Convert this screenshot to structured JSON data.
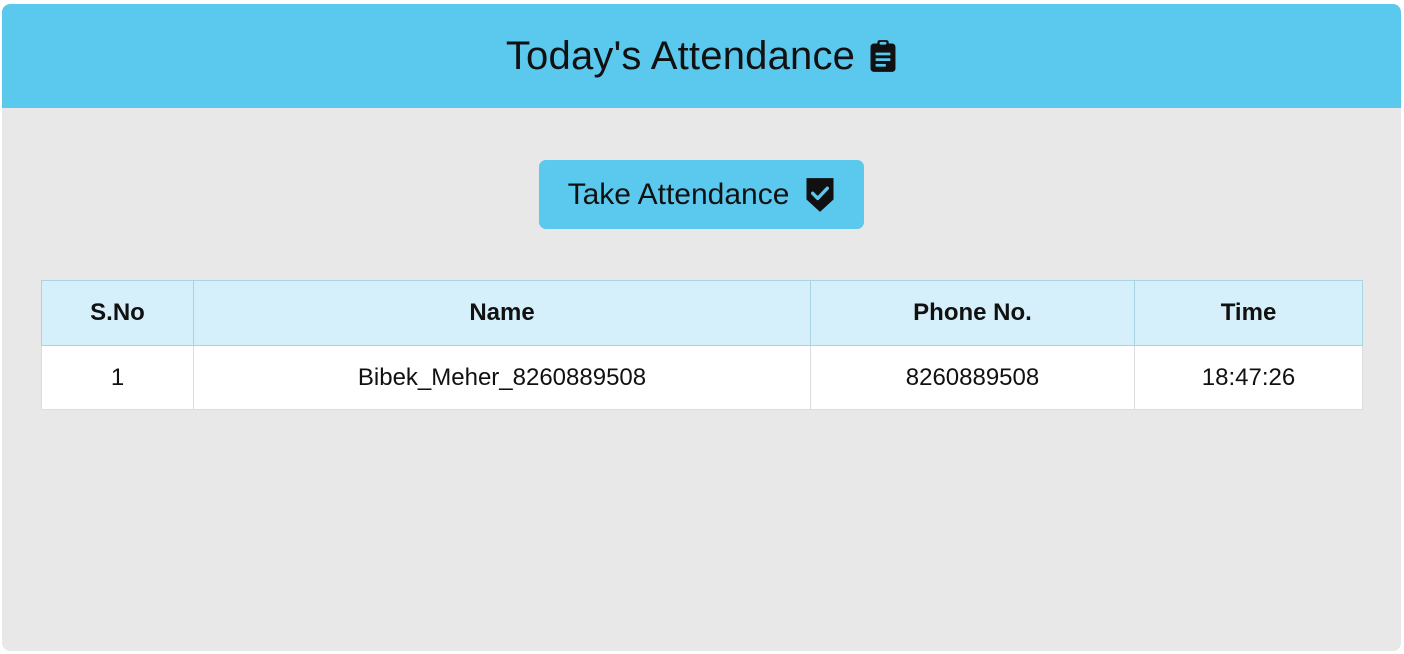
{
  "header": {
    "title": "Today's Attendance",
    "icon": "clipboard-icon",
    "background": "#5bc8ee"
  },
  "actions": {
    "take_attendance_label": "Take Attendance",
    "take_attendance_icon": "shield-check-icon"
  },
  "table": {
    "columns": [
      "S.No",
      "Name",
      "Phone No.",
      "Time"
    ],
    "rows": [
      [
        "1",
        "Bibek_Meher_8260889508",
        "8260889508",
        "18:47:26"
      ]
    ]
  }
}
